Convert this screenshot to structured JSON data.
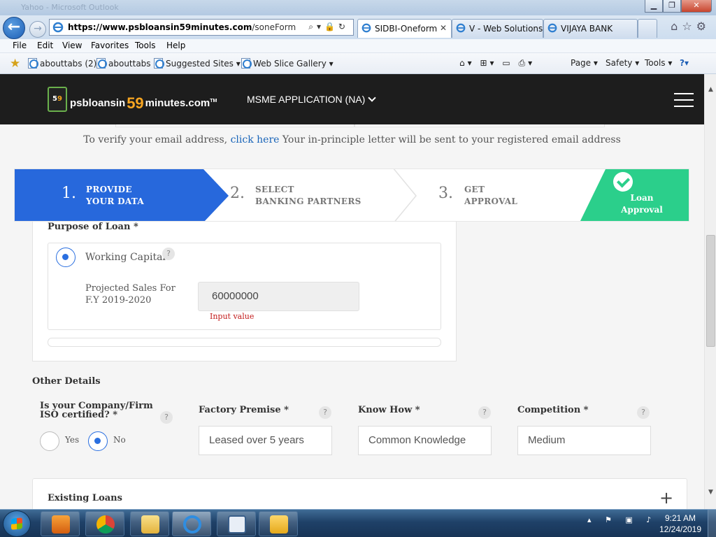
{
  "browser": {
    "window_title_ghost": "Yahoo - Microsoft Outlook",
    "url_host": "https://www.psbloansin59minutes.com",
    "url_path": "/soneForm",
    "tabs": [
      {
        "label": "SIDBI-Oneform",
        "active": true
      },
      {
        "label": "V - Web Solutions",
        "active": false
      },
      {
        "label": "VIJAYA BANK",
        "active": false
      }
    ],
    "menu": [
      "File",
      "Edit",
      "View",
      "Favorites",
      "Tools",
      "Help"
    ],
    "favorites": [
      "abouttabs (2)",
      "abouttabs",
      "Suggested Sites ▾",
      "Web Slice Gallery ▾"
    ],
    "command_bar": [
      "Page ▾",
      "Safety ▾",
      "Tools ▾"
    ]
  },
  "site": {
    "logo_badge": "PSB 59",
    "logo_pre": "psbloansin",
    "logo_num": "59",
    "logo_post": "minutes.com",
    "logo_tm": "TM",
    "application_menu": "MSME APPLICATION (NA)"
  },
  "verify": {
    "before": "To verify your email address, ",
    "link": "click here",
    "after": " Your in-principle letter will be sent to your registered email address"
  },
  "steps": [
    {
      "num": "1.",
      "line1": "PROVIDE",
      "line2": "YOUR DATA",
      "state": "active"
    },
    {
      "num": "2.",
      "line1": "SELECT",
      "line2": "BANKING PARTNERS",
      "state": "pending"
    },
    {
      "num": "3.",
      "line1": "GET",
      "line2": "APPROVAL",
      "state": "pending"
    },
    {
      "line1": "Loan",
      "line2": "Approval",
      "state": "final"
    }
  ],
  "purpose": {
    "title": "Purpose of Loan *",
    "option": "Working Capital",
    "help": "?",
    "projected_label": "Projected Sales For F.Y 2019-2020",
    "projected_value": "60000000",
    "projected_hint": "Input value"
  },
  "other_details": {
    "title": "Other Details",
    "iso": {
      "label": "Is your Company/Firm ISO certified? *",
      "options": [
        "Yes",
        "No"
      ],
      "selected": "No"
    },
    "factory": {
      "label": "Factory Premise *",
      "value": "Leased over 5 years"
    },
    "know_how": {
      "label": "Know How *",
      "value": "Common Knowledge"
    },
    "competition": {
      "label": "Competition *",
      "value": "Medium"
    }
  },
  "existing_loans": {
    "title": "Existing Loans",
    "toggle": "+"
  },
  "taskbar": {
    "time": "9:21 AM",
    "date": "12/24/2019"
  },
  "colors": {
    "active_step": "#2768dc",
    "approval": "#2bcf8b",
    "header_bg": "#1d1d1d",
    "logo_accent": "#f6a521",
    "error": "#c21a1a"
  }
}
